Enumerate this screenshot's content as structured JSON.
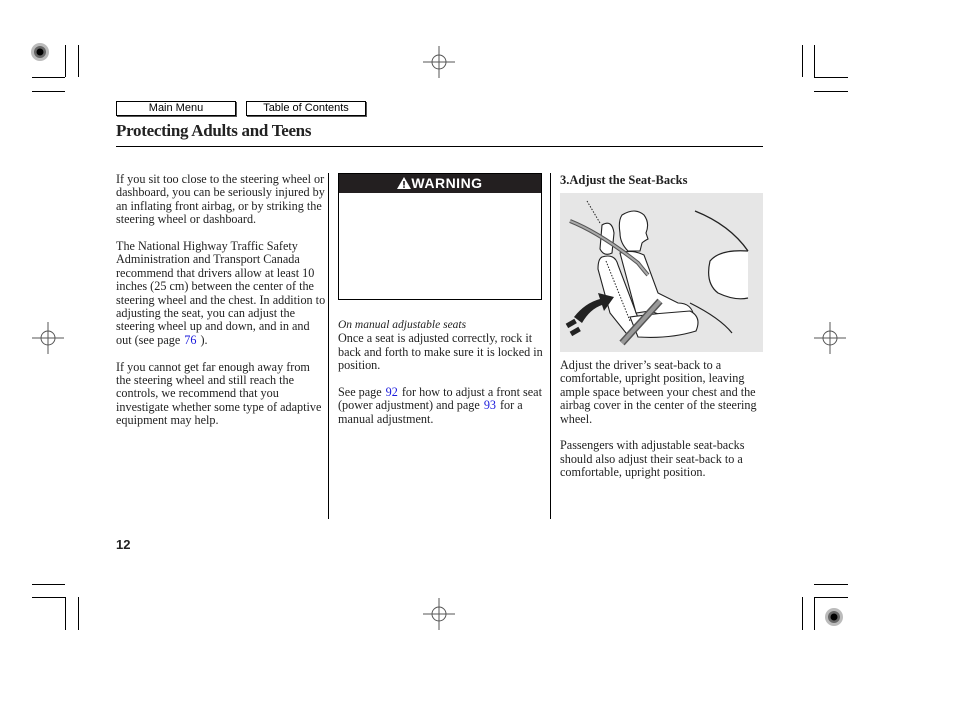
{
  "nav": {
    "main_menu": "Main Menu",
    "table_of_contents": "Table of Contents"
  },
  "page": {
    "title": "Protecting Adults and Teens",
    "page_number": "12"
  },
  "column1": {
    "p1": "If you sit too close to the steering wheel or dashboard, you can be seriously injured by an inflating front airbag, or by striking the steering wheel or dashboard.",
    "p2_before": "The National Highway Traffic Safety Administration and Transport Canada recommend that drivers allow at least 10 inches (25 cm) between the center of the steering wheel and the chest. In addition to adjusting the seat, you can adjust the steering wheel up and down, and in and out (see page",
    "p2_link": "76",
    "p2_after": ").",
    "p3": "If you cannot get far enough away from the steering wheel and still reach the controls, we recommend that you investigate whether some type of adaptive equipment may help."
  },
  "column2": {
    "warning_label": "WARNING",
    "warning_icon": "warning-triangle-icon",
    "subheading": "On manual adjustable seats",
    "p1": "Once a seat is adjusted correctly, rock it back and forth to make sure it is locked in position.",
    "p2_a": "See page",
    "p2_link1": "92",
    "p2_b": "for how to adjust a front seat (power adjustment) and page",
    "p2_link2": "93",
    "p2_c": "for a manual adjustment."
  },
  "column3": {
    "heading": "3.Adjust the Seat-Backs",
    "illustration": "seat-back-adjustment-illustration",
    "p1": "Adjust the driver’s seat-back to a comfortable, upright position, leaving ample space between your chest and the airbag cover in the center of the steering wheel.",
    "p2": "Passengers with adjustable seat-backs should also adjust their seat-back to a comfortable, upright position."
  },
  "colors": {
    "link": "#1a1adb",
    "warning_header_bg": "#231f20",
    "illustration_bg": "#e6e6e6"
  }
}
